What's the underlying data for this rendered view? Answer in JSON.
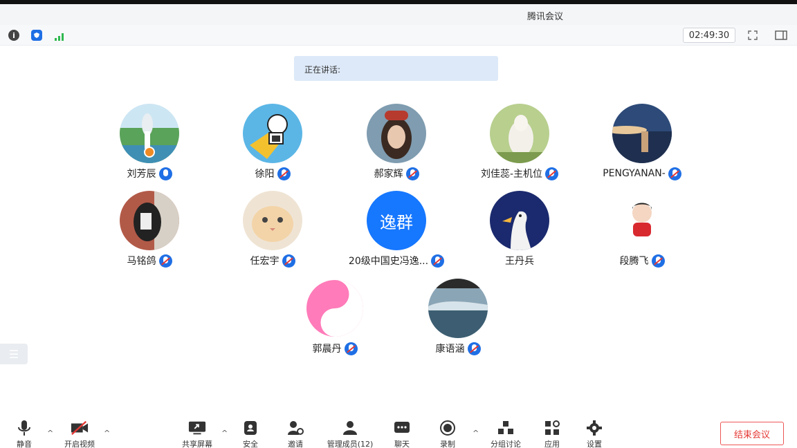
{
  "window": {
    "title": "腾讯会议"
  },
  "infobar": {
    "info_icon": "info-icon",
    "shield_icon": "shield-icon",
    "signal_icon": "signal-icon",
    "timer": "02:49:30",
    "fullscreen_icon": "fullscreen-icon",
    "layout_icon": "layout-icon"
  },
  "speaking": {
    "label": "正在讲话:"
  },
  "participants": [
    {
      "name": "刘芳辰",
      "mic": "on",
      "host": true,
      "avatar": "photo-landscape"
    },
    {
      "name": "徐阳",
      "mic": "muted",
      "avatar": "cartoon-dog"
    },
    {
      "name": "郝家辉",
      "mic": "muted",
      "avatar": "photo-person"
    },
    {
      "name": "刘佳蕊-主机位",
      "mic": "muted",
      "avatar": "photo-lamb"
    },
    {
      "name": "PENGYANAN-",
      "mic": "muted",
      "avatar": "photo-dusk"
    },
    {
      "name": "马铭鸽",
      "mic": "muted",
      "avatar": "photo-selfie"
    },
    {
      "name": "任宏宇",
      "mic": "muted",
      "avatar": "photo-cat"
    },
    {
      "name": "20级中国史冯逸...",
      "mic": "muted",
      "avatar": "text",
      "avatar_text": "逸群"
    },
    {
      "name": "王丹兵",
      "mic": "none",
      "avatar": "cartoon-duck"
    },
    {
      "name": "段腾飞",
      "mic": "muted",
      "avatar": "cartoon-boy"
    },
    {
      "name": "郭晨丹",
      "mic": "muted",
      "avatar": "yin-yang"
    },
    {
      "name": "康语涵",
      "mic": "muted",
      "avatar": "photo-lake"
    }
  ],
  "toolbar": {
    "items": [
      {
        "label": "静音",
        "icon": "microphone-icon"
      },
      {
        "label": "开启视频",
        "icon": "video-off-icon"
      },
      {
        "label": "共享屏幕",
        "icon": "share-screen-icon"
      },
      {
        "label": "安全",
        "icon": "security-icon"
      },
      {
        "label": "邀请",
        "icon": "invite-icon"
      },
      {
        "label": "管理成员(12)",
        "icon": "members-icon"
      },
      {
        "label": "聊天",
        "icon": "chat-icon"
      },
      {
        "label": "录制",
        "icon": "record-icon"
      },
      {
        "label": "分组讨论",
        "icon": "breakout-icon"
      },
      {
        "label": "应用",
        "icon": "apps-icon"
      },
      {
        "label": "设置",
        "icon": "settings-icon"
      }
    ],
    "end_label": "结束会议"
  },
  "colors": {
    "accent": "#1f6fe5",
    "end": "#e53935",
    "speaking_bg": "#dde9f8"
  }
}
